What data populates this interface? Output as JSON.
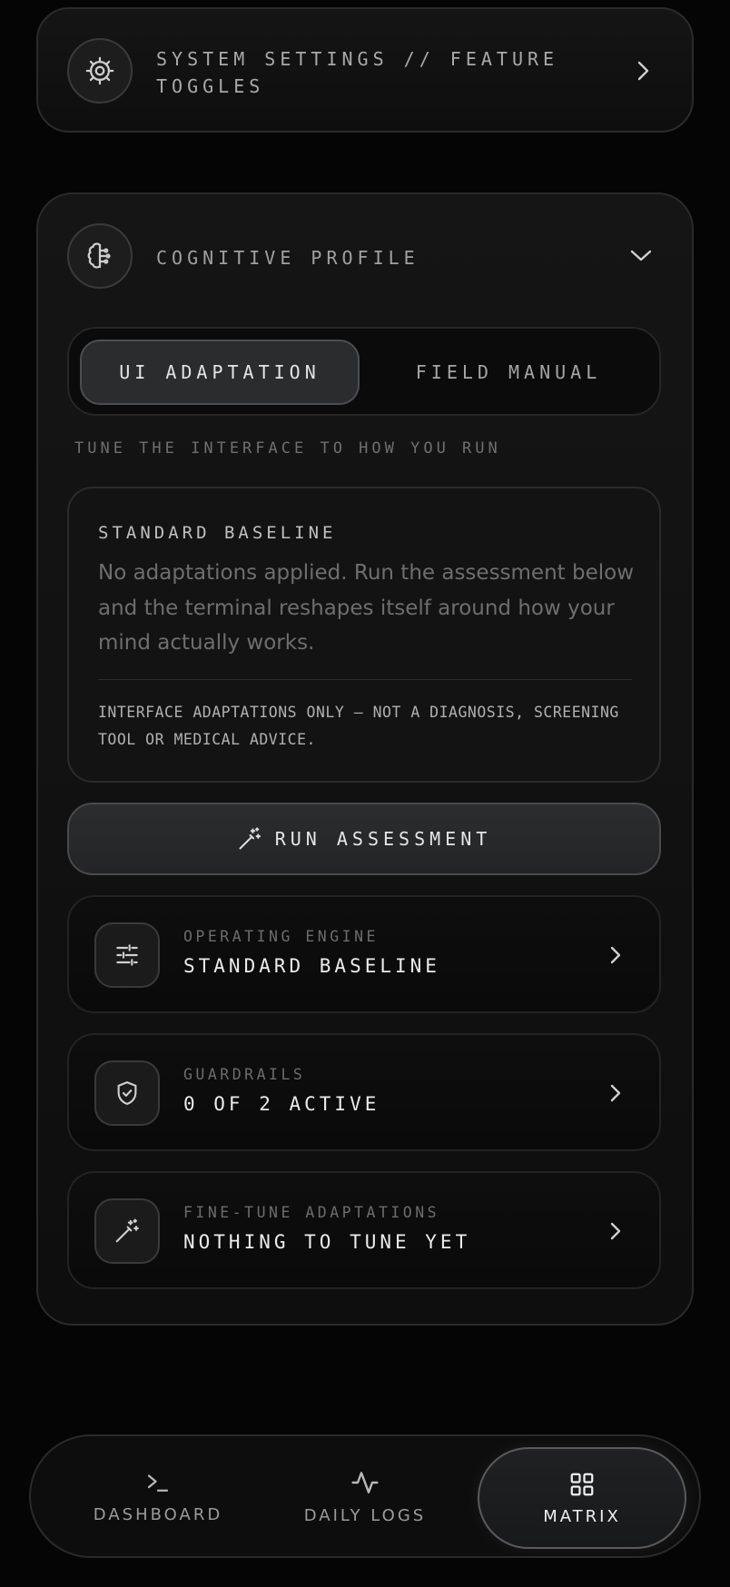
{
  "settings": {
    "title": "SYSTEM SETTINGS // FEATURE TOGGLES",
    "icon": "gear-icon"
  },
  "profile": {
    "title": "COGNITIVE PROFILE",
    "icon": "brain-icon",
    "tabs": [
      {
        "label": "UI ADAPTATION",
        "selected": true
      },
      {
        "label": "FIELD MANUAL",
        "selected": false
      }
    ],
    "caption": "TUNE THE INTERFACE TO HOW YOU RUN",
    "baseline": {
      "title": "STANDARD BASELINE",
      "description": "No adaptations applied. Run the assessment below and the terminal reshapes itself around how your mind actually works.",
      "disclaimer": "INTERFACE ADAPTATIONS ONLY — NOT A DIAGNOSIS, SCREENING TOOL OR MEDICAL ADVICE."
    },
    "run_button": {
      "label": "RUN ASSESSMENT",
      "icon": "magic-wand-icon"
    },
    "rows": [
      {
        "label": "OPERATING ENGINE",
        "value": "STANDARD BASELINE",
        "icon": "sliders-icon"
      },
      {
        "label": "GUARDRAILS",
        "value": "0 OF 2 ACTIVE",
        "icon": "shield-check-icon"
      },
      {
        "label": "FINE-TUNE ADAPTATIONS",
        "value": "NOTHING TO TUNE YET",
        "icon": "magic-wand-icon"
      }
    ]
  },
  "nav": {
    "items": [
      {
        "label": "DASHBOARD",
        "icon": "terminal-icon",
        "active": false
      },
      {
        "label": "DAILY LOGS",
        "icon": "activity-icon",
        "active": false
      },
      {
        "label": "MATRIX",
        "icon": "grid-icon",
        "active": true
      }
    ]
  }
}
